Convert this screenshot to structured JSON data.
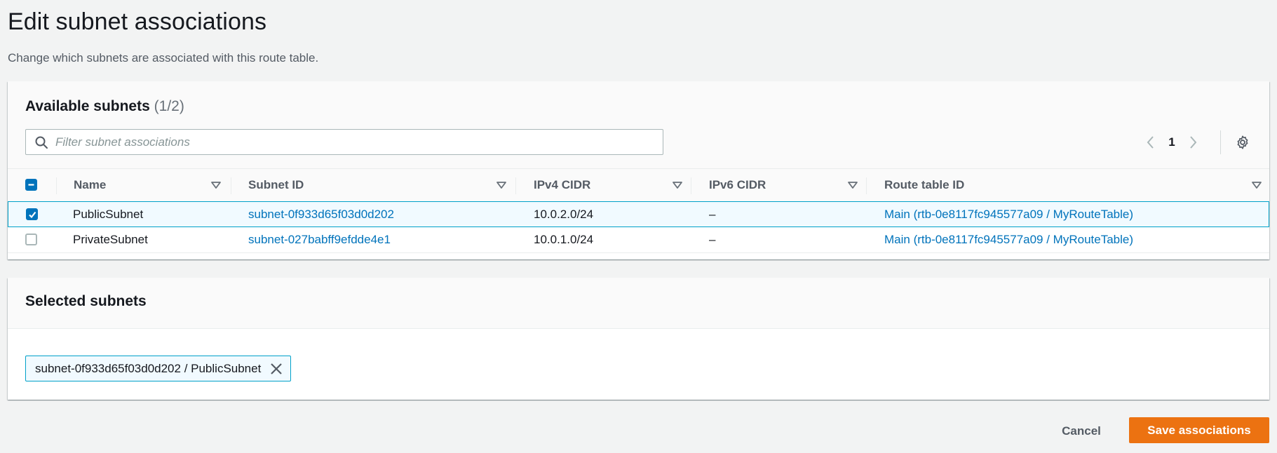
{
  "page": {
    "title": "Edit subnet associations",
    "description": "Change which subnets are associated with this route table."
  },
  "available": {
    "title": "Available subnets",
    "count": "(1/2)",
    "filter_placeholder": "Filter subnet associations",
    "page_number": "1",
    "columns": [
      "Name",
      "Subnet ID",
      "IPv4 CIDR",
      "IPv6 CIDR",
      "Route table ID"
    ],
    "rows": [
      {
        "checked": true,
        "name": "PublicSubnet",
        "subnet_id": "subnet-0f933d65f03d0d202",
        "ipv4": "10.0.2.0/24",
        "ipv6": "–",
        "route_table": "Main (rtb-0e8117fc945577a09 / MyRouteTable)"
      },
      {
        "checked": false,
        "name": "PrivateSubnet",
        "subnet_id": "subnet-027babff9efdde4e1",
        "ipv4": "10.0.1.0/24",
        "ipv6": "–",
        "route_table": "Main (rtb-0e8117fc945577a09 / MyRouteTable)"
      }
    ]
  },
  "selected": {
    "title": "Selected subnets",
    "tokens": [
      "subnet-0f933d65f03d0d202 / PublicSubnet"
    ]
  },
  "actions": {
    "cancel": "Cancel",
    "save": "Save associations"
  },
  "colors": {
    "accent": "#0073bb",
    "primary_button": "#ec7211",
    "selected_row": "#f1faff"
  }
}
